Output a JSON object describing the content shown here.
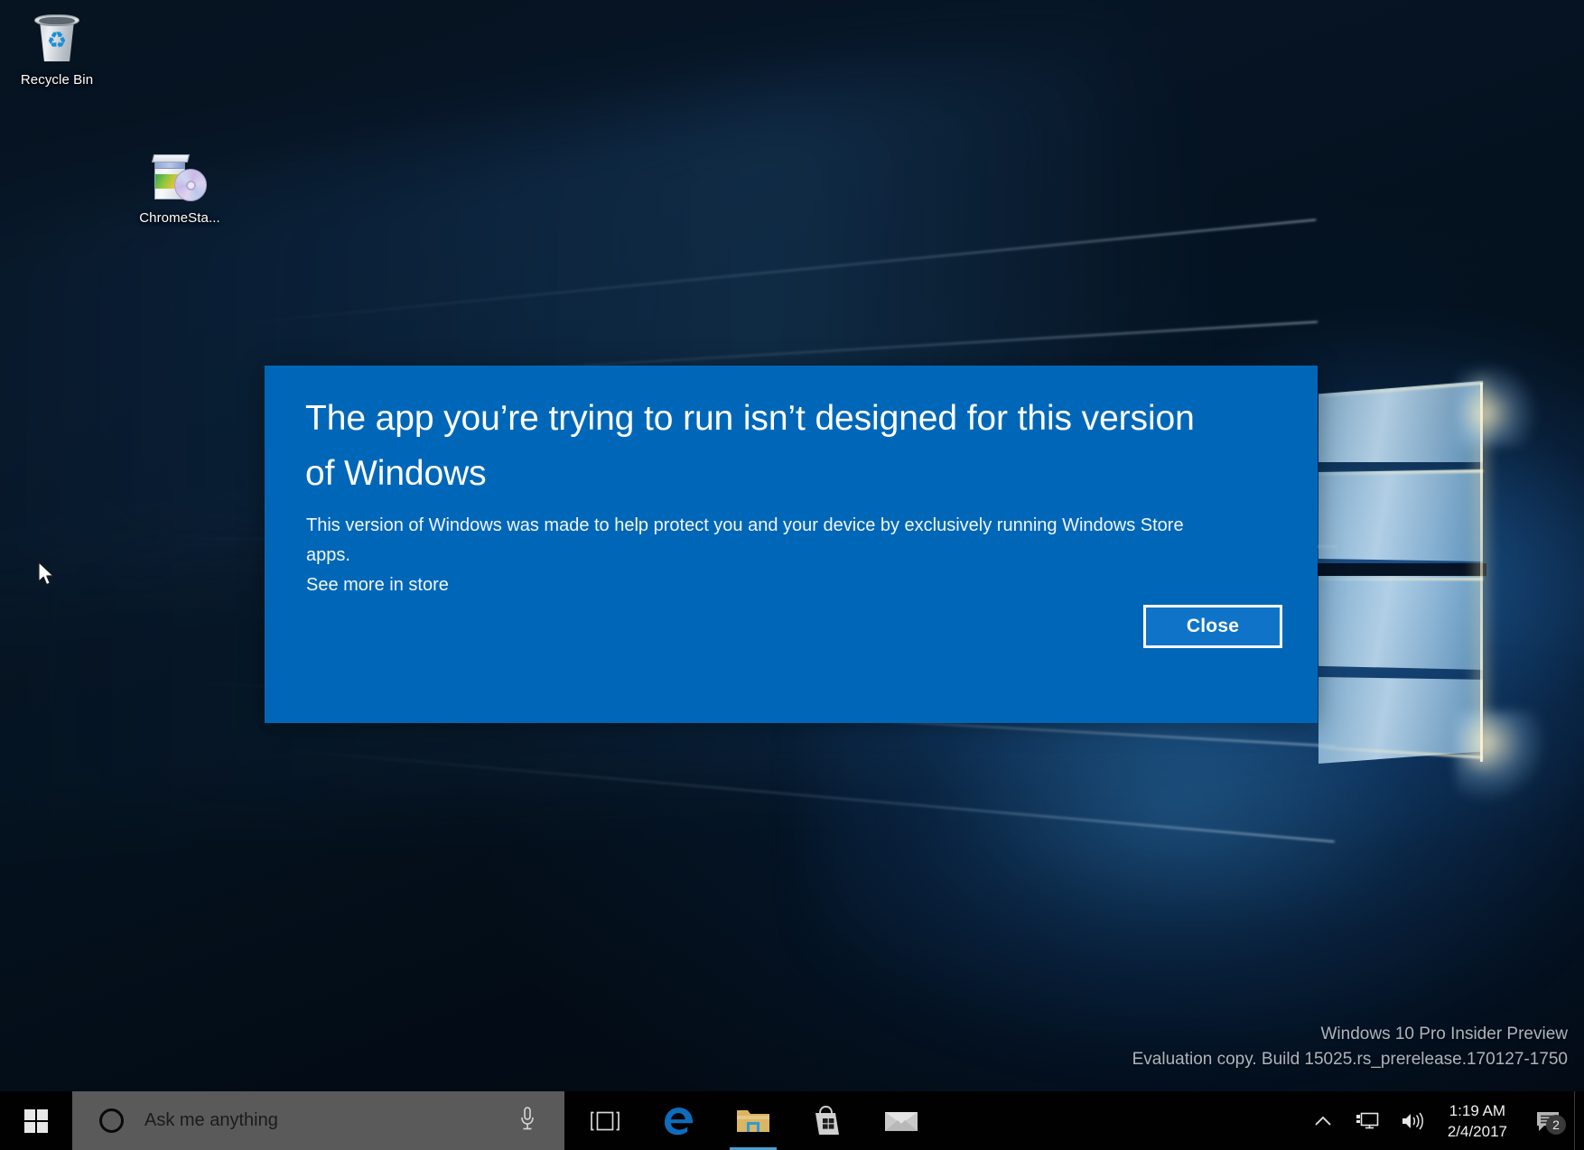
{
  "desktop": {
    "icons": [
      {
        "name": "recycle-bin",
        "label": "Recycle Bin"
      },
      {
        "name": "chrome-standalone",
        "label": "ChromeSta..."
      }
    ],
    "watermark": {
      "line1": "Windows 10 Pro Insider Preview",
      "line2": "Evaluation copy. Build 15025.rs_prerelease.170127-1750"
    },
    "cursor_icon": "arrow-pointer-cursor"
  },
  "dialog": {
    "title": "The app you’re trying to run isn’t designed for this version of Windows",
    "body": "This version of Windows was made to help protect you and your device by exclusively running Windows Store apps.",
    "link": "See more in store",
    "close_label": "Close",
    "background_color": "#0067b8",
    "button_fill_color": "#0f74c8",
    "button_border_color": "#ffffff"
  },
  "taskbar": {
    "background_color": "#010101",
    "start_label": "Start",
    "start_icon": "windows-logo-icon",
    "search": {
      "placeholder": "Ask me anything",
      "value": "",
      "cortana_icon": "cortana-circle-icon",
      "mic_icon": "microphone-icon",
      "background_color": "#5a5a5a"
    },
    "pinned": [
      {
        "name": "task-view",
        "icon": "task-view-icon",
        "label": "Task View",
        "active": false
      },
      {
        "name": "microsoft-edge",
        "icon": "edge-icon",
        "label": "Microsoft Edge",
        "active": false
      },
      {
        "name": "file-explorer",
        "icon": "folder-icon",
        "label": "File Explorer",
        "active": true
      },
      {
        "name": "microsoft-store",
        "icon": "store-bag-icon",
        "label": "Store",
        "active": false
      },
      {
        "name": "mail",
        "icon": "envelope-icon",
        "label": "Mail",
        "active": false
      }
    ],
    "tray": {
      "chevron_icon": "chevron-up-icon",
      "network_icon": "network-monitor-icon",
      "volume_icon": "speaker-icon",
      "time": "1:19 AM",
      "date": "2/4/2017",
      "action_center_icon": "action-center-icon",
      "action_center_badge": "2",
      "active_underline_color": "#4e9ed4"
    }
  }
}
